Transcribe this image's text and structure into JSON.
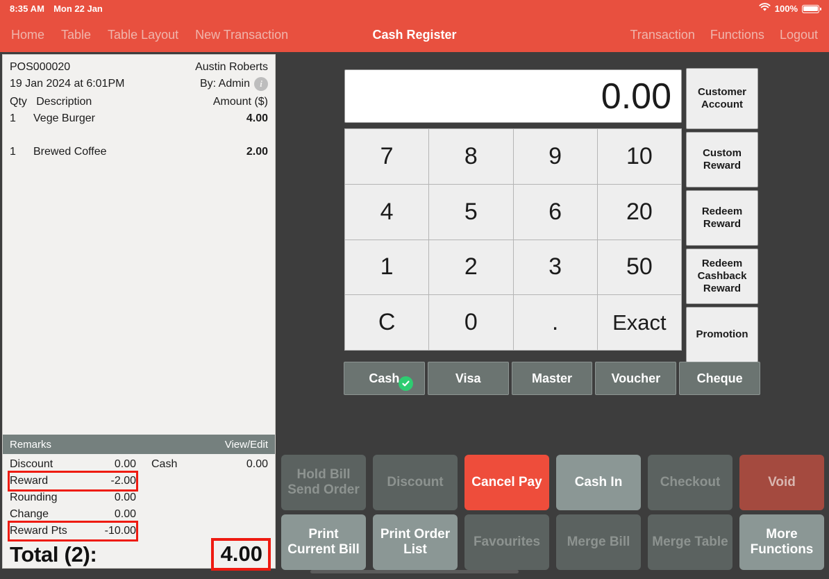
{
  "statusbar": {
    "time": "8:35 AM",
    "date": "Mon 22 Jan",
    "battery_percent": "100%",
    "wifi_icon": "wifi-icon",
    "battery_icon": "battery-icon"
  },
  "navbar": {
    "title": "Cash Register",
    "left_items": [
      {
        "label": "Home"
      },
      {
        "label": "Table"
      },
      {
        "label": "Table Layout"
      },
      {
        "label": "New Transaction"
      }
    ],
    "right_items": [
      {
        "label": "Transaction"
      },
      {
        "label": "Functions"
      },
      {
        "label": "Logout"
      }
    ]
  },
  "receipt": {
    "order_no": "POS000020",
    "customer": "Austin Roberts",
    "datetime": "19 Jan 2024 at 6:01PM",
    "by": "By: Admin",
    "info_icon": "info-icon",
    "col_qty": "Qty",
    "col_desc": "Description",
    "col_amount": "Amount ($)",
    "items": [
      {
        "qty": "1",
        "desc": "Vege Burger",
        "amount": "4.00"
      },
      {
        "qty": "1",
        "desc": "Brewed Coffee",
        "amount": "2.00"
      }
    ],
    "remarks_label": "Remarks",
    "remarks_action": "View/Edit",
    "totals_left": [
      {
        "label": "Discount",
        "value": "0.00",
        "highlight": false
      },
      {
        "label": "Reward",
        "value": "-2.00",
        "highlight": true
      },
      {
        "label": "Rounding",
        "value": "0.00",
        "highlight": false
      },
      {
        "label": "Change",
        "value": "0.00",
        "highlight": false
      },
      {
        "label": "Reward Pts",
        "value": "-10.00",
        "highlight": true
      }
    ],
    "totals_right": [
      {
        "label": "Cash",
        "value": "0.00"
      }
    ],
    "total_label": "Total (2):",
    "total_value": "4.00"
  },
  "register": {
    "display_value": "0.00",
    "keypad": [
      "7",
      "8",
      "9",
      "10",
      "4",
      "5",
      "6",
      "20",
      "1",
      "2",
      "3",
      "50",
      "C",
      "0",
      ".",
      "Exact"
    ],
    "side_buttons": [
      {
        "label": "Customer Account"
      },
      {
        "label": "Custom Reward"
      },
      {
        "label": "Redeem Reward"
      },
      {
        "label": "Redeem Cashback Reward"
      },
      {
        "label": "Promotion"
      }
    ],
    "payment_types": [
      {
        "label": "Cash",
        "selected": true
      },
      {
        "label": "Visa",
        "selected": false
      },
      {
        "label": "Master",
        "selected": false
      },
      {
        "label": "Voucher",
        "selected": false
      },
      {
        "label": "Cheque",
        "selected": false
      }
    ],
    "selected_check_icon": "check-circle-icon"
  },
  "actions": [
    {
      "label": "Hold Bill Send Order",
      "state": "disabled"
    },
    {
      "label": "Discount",
      "state": "disabled"
    },
    {
      "label": "Cancel Pay",
      "state": "red"
    },
    {
      "label": "Cash In",
      "state": "enabled"
    },
    {
      "label": "Checkout",
      "state": "disabled"
    },
    {
      "label": "Void",
      "state": "void"
    },
    {
      "label": "Print Current Bill",
      "state": "enabled"
    },
    {
      "label": "Print Order List",
      "state": "enabled"
    },
    {
      "label": "Favourites",
      "state": "disabled"
    },
    {
      "label": "Merge Bill",
      "state": "disabled"
    },
    {
      "label": "Merge Table",
      "state": "disabled"
    },
    {
      "label": "More Functions",
      "state": "enabled"
    }
  ],
  "colors": {
    "accent_red": "#e8503f",
    "highlight_red": "#ee1b11",
    "dark_bg": "#3d3d3d",
    "receipt_bg": "#f2f1ef",
    "remarks_bar": "#75807e",
    "pay_btn": "#6b7471",
    "enabled_btn": "#8b9795",
    "disabled_btn": "#5b6260",
    "void_btn": "#a44a3f",
    "check_green": "#2ecc71"
  }
}
